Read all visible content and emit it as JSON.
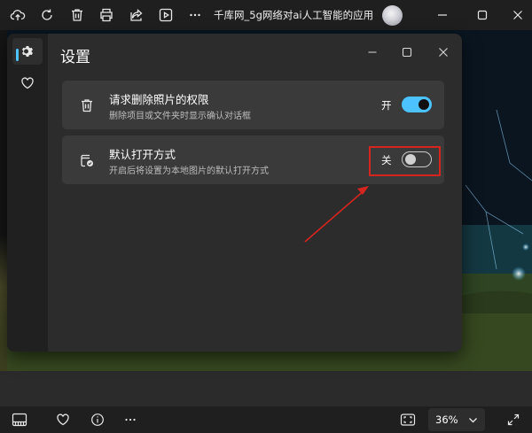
{
  "toolbar": {
    "document_title": "千库网_5g网络对ai人工智能的应用结..."
  },
  "settings": {
    "title": "设置",
    "nav": [
      {
        "name": "settings",
        "icon": "gear-icon",
        "active": true
      },
      {
        "name": "favorites",
        "icon": "heart-icon",
        "active": false
      }
    ],
    "items": [
      {
        "title": "请求删除照片的权限",
        "description": "删除项目或文件夹时显示确认对话框",
        "icon": "trash-icon",
        "toggle_label": "开",
        "toggle_on": true
      },
      {
        "title": "默认打开方式",
        "description": "开启后将设置为本地图片的默认打开方式",
        "icon": "default-app-icon",
        "toggle_label": "关",
        "toggle_on": false
      }
    ]
  },
  "bottombar": {
    "zoom": "36%"
  },
  "colors": {
    "accent": "#4cc2ff",
    "annotation": "#d6241e",
    "panel": "#2c2c2c",
    "card": "#3a3a3a"
  }
}
